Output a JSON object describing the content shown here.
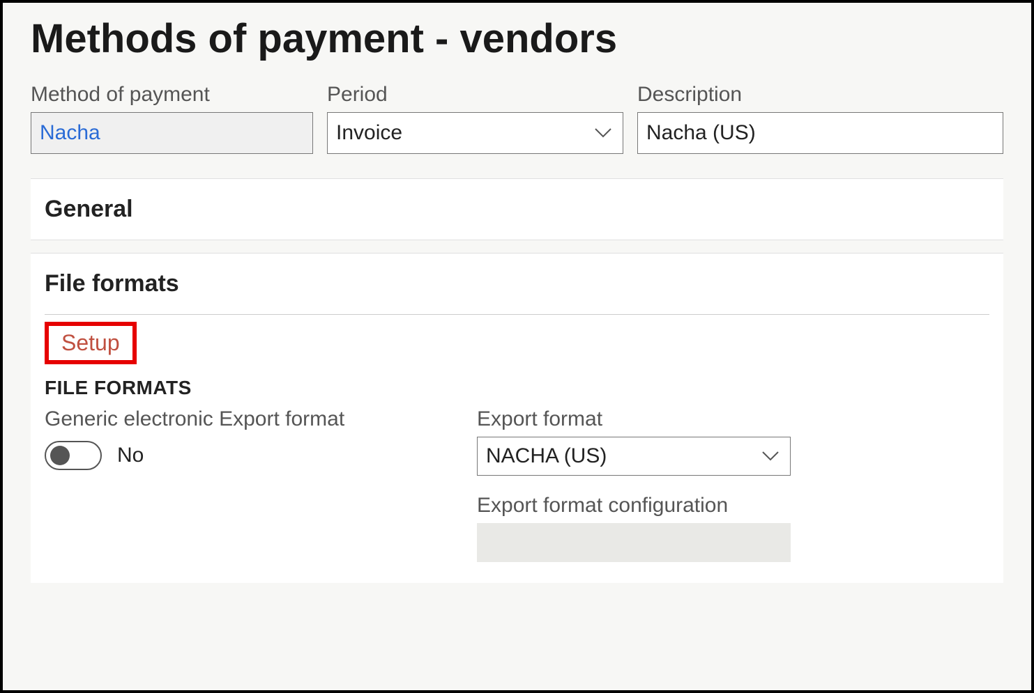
{
  "page": {
    "title": "Methods of payment - vendors"
  },
  "fields": {
    "methodOfPayment": {
      "label": "Method of payment",
      "value": "Nacha"
    },
    "period": {
      "label": "Period",
      "value": "Invoice"
    },
    "description": {
      "label": "Description",
      "value": "Nacha (US)"
    }
  },
  "fasttabs": {
    "general": {
      "title": "General"
    },
    "fileFormats": {
      "title": "File formats",
      "setupLink": "Setup",
      "sectionLabel": "FILE FORMATS",
      "genericExport": {
        "label": "Generic electronic Export format",
        "value": "No"
      },
      "exportFormat": {
        "label": "Export format",
        "value": "NACHA (US)"
      },
      "exportFormatConfig": {
        "label": "Export format configuration",
        "value": ""
      }
    }
  }
}
